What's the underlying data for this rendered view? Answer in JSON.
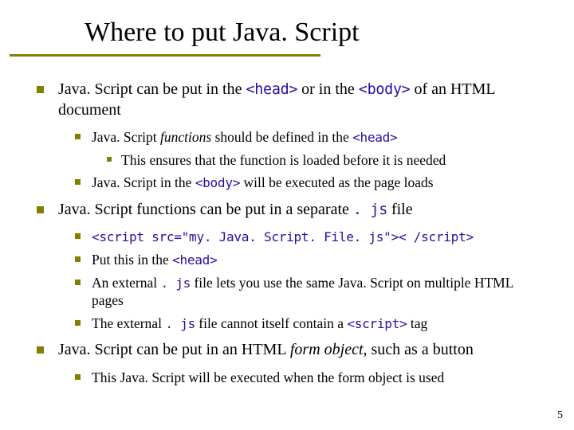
{
  "title": "Where to put Java. Script",
  "p1": {
    "pre": "Java. Script can be put in the ",
    "c1": "<head>",
    "mid": " or in the ",
    "c2": "<body>",
    "post": " of an HTML document"
  },
  "p1s1": {
    "pre": "Java. Script ",
    "it": "functions",
    "mid": " should be defined in the ",
    "c1": "<head>"
  },
  "p1s1a": "This ensures that the function is loaded before it is needed",
  "p1s2": {
    "pre": "Java. Script in the ",
    "c1": "<body>",
    "post": " will be executed as the page loads"
  },
  "p2": {
    "pre": "Java. Script functions can be put in a separate ",
    "c1": ". js",
    "post": " file"
  },
  "p2s1": "<script src=\"my. Java. Script. File. js\">< /script>",
  "p2s2": {
    "pre": "Put this in the ",
    "c1": "<head>"
  },
  "p2s3": {
    "pre": "An external ",
    "c1": ". js",
    "post": " file lets you use the same Java. Script on multiple HTML pages"
  },
  "p2s4": {
    "pre": "The external ",
    "c1": ". js",
    "mid": " file cannot itself contain a ",
    "c2": "<script>",
    "post": " tag"
  },
  "p3": {
    "pre": "Java. Script can be put in an HTML ",
    "it": "form object,",
    "post": " such as a button"
  },
  "p3s1": "This Java. Script will be executed when the form object is used",
  "pagenum": "5"
}
